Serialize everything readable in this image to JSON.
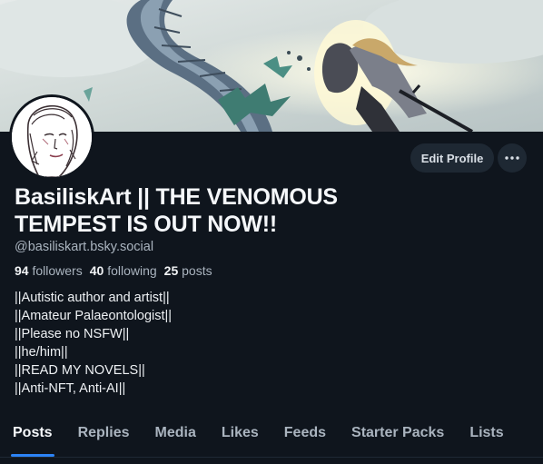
{
  "profile": {
    "display_name": "BasiliskArt || THE VENOMOUS TEMPEST IS OUT NOW!!",
    "handle": "@basiliskart.bsky.social",
    "followers_count": "94",
    "followers_label": "followers",
    "following_count": "40",
    "following_label": "following",
    "posts_count": "25",
    "posts_label": "posts",
    "bio_lines": [
      "||Autistic author and artist||",
      "||Amateur Palaeontologist||",
      "||Please no NSFW||",
      "||he/him||",
      "||READ MY NOVELS||",
      "||Anti-NFT, Anti-AI||"
    ]
  },
  "actions": {
    "edit_profile_label": "Edit Profile",
    "more_label": "···"
  },
  "tabs": [
    {
      "label": "Posts",
      "active": true
    },
    {
      "label": "Replies",
      "active": false
    },
    {
      "label": "Media",
      "active": false
    },
    {
      "label": "Likes",
      "active": false
    },
    {
      "label": "Feeds",
      "active": false
    },
    {
      "label": "Starter Packs",
      "active": false
    },
    {
      "label": "Lists",
      "active": false
    }
  ],
  "colors": {
    "background": "#0f151d",
    "accent": "#2c83f5",
    "muted_text": "#aab4bf",
    "button_bg": "#1e2833"
  }
}
